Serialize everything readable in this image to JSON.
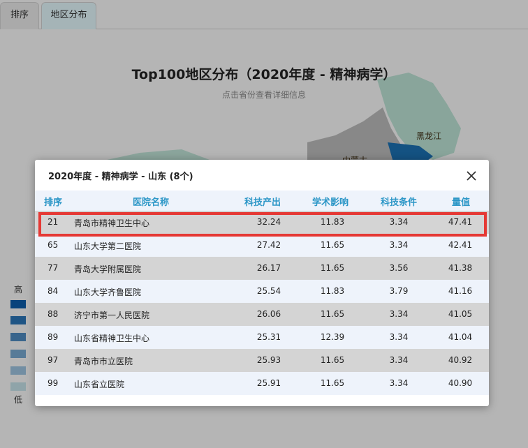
{
  "tabs": [
    {
      "label": "排序"
    },
    {
      "label": "地区分布"
    }
  ],
  "map": {
    "title": "Top100地区分布（2020年度 - 精神病学）",
    "subtitle": "点击省份查看详细信息",
    "labels": [
      "黑龙江",
      "内蒙古"
    ],
    "legend": {
      "high": "高",
      "low": "低",
      "colors": [
        "#0b5ba8",
        "#2b73b4",
        "#4d89bd",
        "#76a6cd",
        "#9ac0dc",
        "#c2dde5"
      ]
    }
  },
  "modal": {
    "title": "2020年度 - 精神病学 - 山东 (8个)",
    "close_icon": "close-icon",
    "columns": [
      "排序",
      "医院名称",
      "科技产出",
      "学术影响",
      "科技条件",
      "量值"
    ],
    "rows": [
      {
        "rank": "21",
        "name": "青岛市精神卫生中心",
        "output": "32.24",
        "impact": "11.83",
        "condition": "3.34",
        "score": "47.41"
      },
      {
        "rank": "65",
        "name": "山东大学第二医院",
        "output": "27.42",
        "impact": "11.65",
        "condition": "3.34",
        "score": "42.41"
      },
      {
        "rank": "77",
        "name": "青岛大学附属医院",
        "output": "26.17",
        "impact": "11.65",
        "condition": "3.56",
        "score": "41.38"
      },
      {
        "rank": "84",
        "name": "山东大学齐鲁医院",
        "output": "25.54",
        "impact": "11.83",
        "condition": "3.79",
        "score": "41.16"
      },
      {
        "rank": "88",
        "name": "济宁市第一人民医院",
        "output": "26.06",
        "impact": "11.65",
        "condition": "3.34",
        "score": "41.05"
      },
      {
        "rank": "89",
        "name": "山东省精神卫生中心",
        "output": "25.31",
        "impact": "12.39",
        "condition": "3.34",
        "score": "41.04"
      },
      {
        "rank": "97",
        "name": "青岛市市立医院",
        "output": "25.93",
        "impact": "11.65",
        "condition": "3.34",
        "score": "40.92"
      },
      {
        "rank": "99",
        "name": "山东省立医院",
        "output": "25.91",
        "impact": "11.65",
        "condition": "3.34",
        "score": "40.90"
      }
    ]
  },
  "colors": {
    "header_text": "#2d97c7",
    "highlight": "#e53935"
  }
}
